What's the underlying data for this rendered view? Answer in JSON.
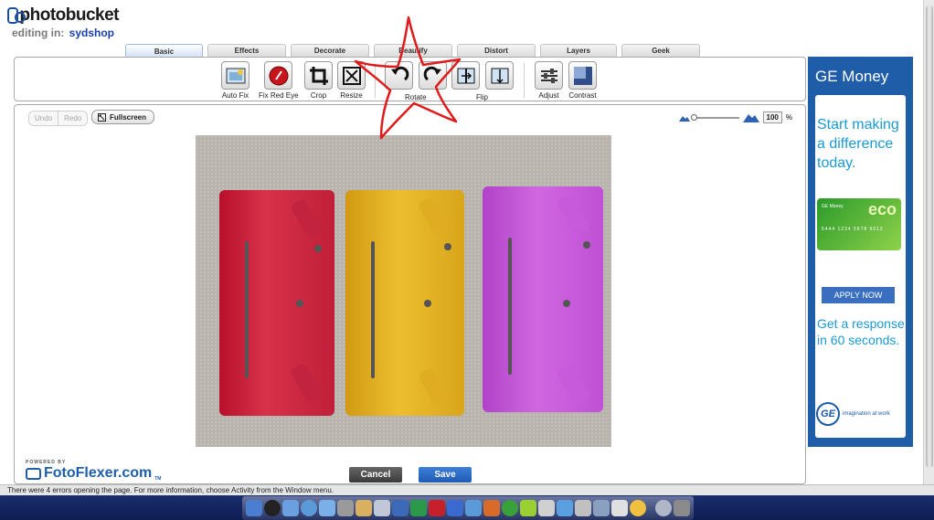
{
  "header": {
    "brand": "photobucket",
    "editing_label": "editing in:",
    "editing_user": "sydshop"
  },
  "tabs": [
    {
      "label": "Basic",
      "active": true
    },
    {
      "label": "Effects",
      "active": false
    },
    {
      "label": "Decorate",
      "active": false
    },
    {
      "label": "Beautify",
      "active": false
    },
    {
      "label": "Distort",
      "active": false
    },
    {
      "label": "Layers",
      "active": false
    },
    {
      "label": "Geek",
      "active": false
    }
  ],
  "toolbar": {
    "auto_fix": "Auto Fix",
    "fix_red_eye": "Fix Red Eye",
    "crop": "Crop",
    "resize": "Resize",
    "rotate": "Rotate",
    "flip": "Flip",
    "adjust": "Adjust",
    "contrast": "Contrast"
  },
  "editor": {
    "undo": "Undo",
    "redo": "Redo",
    "fullscreen": "Fullscreen",
    "zoom_value": "100",
    "zoom_unit": "%",
    "powered_by": "POWERED BY",
    "fotoflexer": "FotoFlexer.com",
    "tm": "TM",
    "cancel": "Cancel",
    "save": "Save"
  },
  "ad": {
    "brand": "GE Money",
    "headline": "Start making a difference today.",
    "card_brand": "GE Money",
    "card_logo": "eco",
    "card_number": "5444 1234 5678 9012",
    "apply": "APPLY NOW",
    "subhead": "Get a response in 60 seconds.",
    "logo": "GE",
    "tagline": "imagination at work"
  },
  "status": {
    "message": "There were 4 errors opening the page. For more information, choose Activity from the Window menu."
  },
  "colors": {
    "accent_blue": "#1f5da8",
    "save_blue": "#2a6ac8",
    "annotation_red": "#e01b1b"
  }
}
